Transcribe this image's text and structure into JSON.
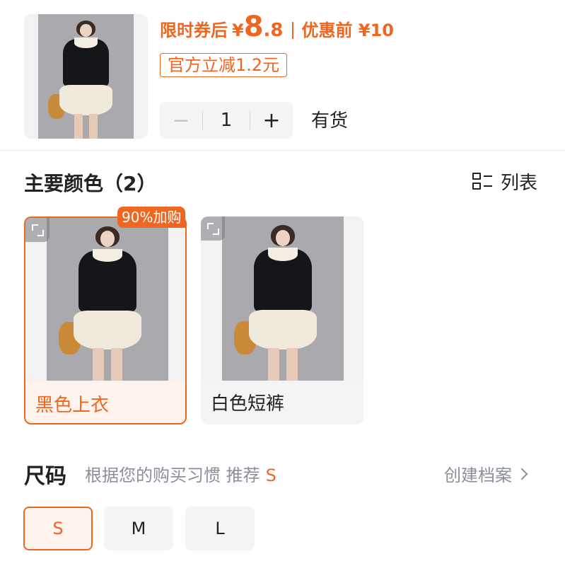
{
  "product": {
    "price_prefix": "限时券后",
    "currency": "¥",
    "price_int": "8",
    "price_dec": ".8",
    "original_label": "优惠前 ¥10",
    "discount_tag": "官方立减1.2元"
  },
  "quantity": {
    "minus": "−",
    "value": "1",
    "plus": "+",
    "stock": "有货"
  },
  "color_section": {
    "title": "主要颜色（2）",
    "list_toggle": "列表",
    "badge": "90%加购",
    "options": [
      {
        "label": "黑色上衣",
        "selected": true
      },
      {
        "label": "白色短裤",
        "selected": false
      }
    ]
  },
  "size_section": {
    "title": "尺码",
    "hint": "根据您的购买习惯 推荐",
    "recommended": "S",
    "profile_link": "创建档案",
    "sizes": [
      {
        "label": "S",
        "selected": true
      },
      {
        "label": "M",
        "selected": false
      },
      {
        "label": "L",
        "selected": false
      }
    ]
  },
  "colors": {
    "accent": "#f0661f",
    "accent_bg": "#fff3ee",
    "muted_text": "#8a8f99",
    "chip_bg": "#f4f4f5"
  }
}
